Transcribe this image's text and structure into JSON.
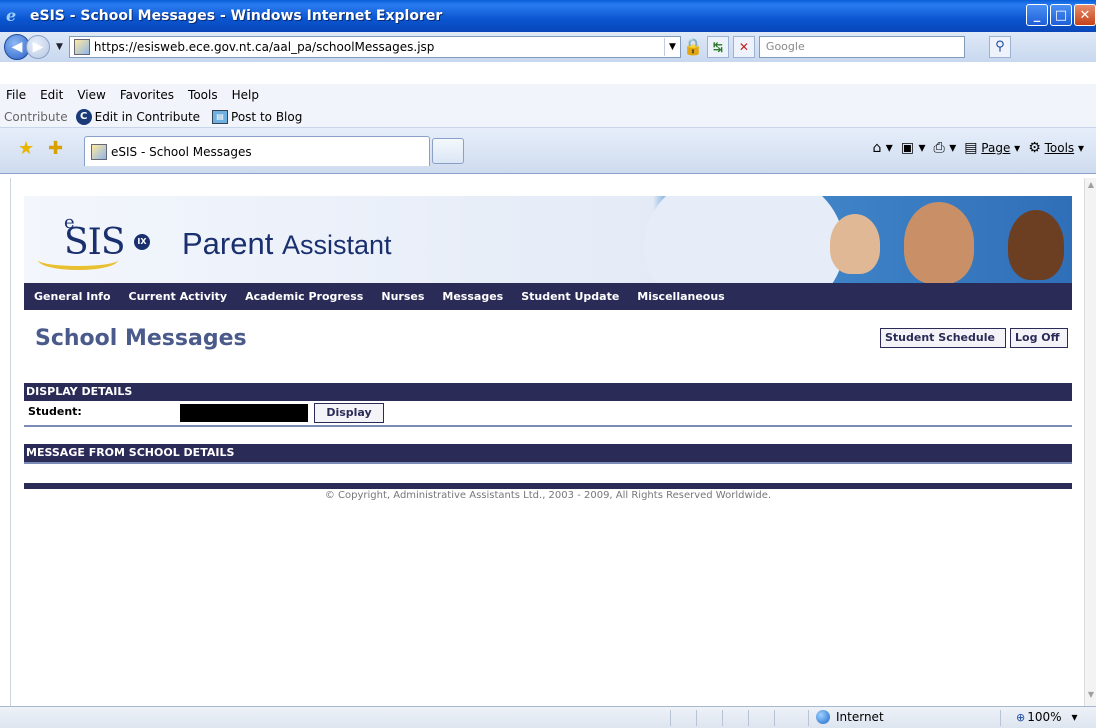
{
  "window": {
    "title": "eSIS - School Messages - Windows Internet Explorer"
  },
  "address": {
    "url": "https://esisweb.ece.gov.nt.ca/aal_pa/schoolMessages.jsp",
    "search_placeholder": "Google"
  },
  "menu": {
    "items": [
      "File",
      "Edit",
      "View",
      "Favorites",
      "Tools",
      "Help"
    ]
  },
  "contribute": {
    "label": "Contribute",
    "edit": "Edit in Contribute",
    "post": "Post to Blog"
  },
  "tab": {
    "title": "eSIS - School Messages"
  },
  "commandbar": {
    "page": "Page",
    "tools": "Tools"
  },
  "banner": {
    "logo_e": "e",
    "logo_sis": "SIS",
    "logo_ix": "IX",
    "title_main": "Parent",
    "title_sub": "Assistant"
  },
  "nav": {
    "items": [
      "General Info",
      "Current Activity",
      "Academic Progress",
      "Nurses",
      "Messages",
      "Student Update",
      "Miscellaneous"
    ]
  },
  "page": {
    "title": "School Messages",
    "student_schedule": "Student Schedule",
    "log_off": "Log Off"
  },
  "display_details": {
    "header": "DISPLAY DETAILS",
    "student_label": "Student:",
    "display_button": "Display"
  },
  "message_details": {
    "header": "MESSAGE FROM SCHOOL DETAILS"
  },
  "footer": {
    "copyright": "© Copyright, Administrative Assistants Ltd., 2003 - 2009, All Rights Reserved Worldwide."
  },
  "status": {
    "zone": "Internet",
    "zoom": "100%"
  }
}
